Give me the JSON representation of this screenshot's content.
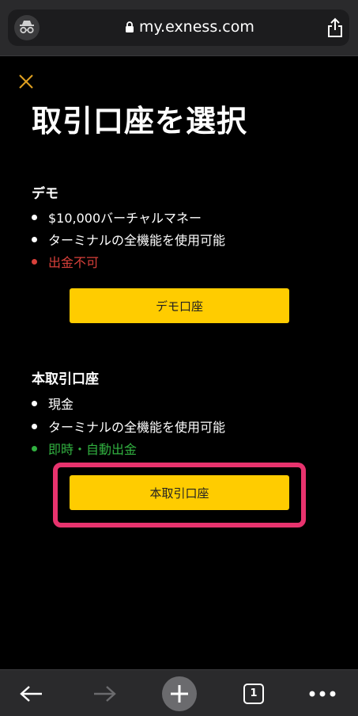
{
  "browser": {
    "url": "my.exness.com",
    "tab_count": "1"
  },
  "page": {
    "title": "取引口座を選択"
  },
  "demo": {
    "heading": "デモ",
    "features": [
      {
        "text": "$10,000バーチャルマネー",
        "color": "#ffffff"
      },
      {
        "text": "ターミナルの全機能を使用可能",
        "color": "#ffffff"
      },
      {
        "text": "出金不可",
        "color": "#d9403a"
      }
    ],
    "button_label": "デモ口座"
  },
  "real": {
    "heading": "本取引口座",
    "features": [
      {
        "text": "現金",
        "color": "#ffffff"
      },
      {
        "text": "ターミナルの全機能を使用可能",
        "color": "#ffffff"
      },
      {
        "text": "即時・自動出金",
        "color": "#31b040"
      }
    ],
    "button_label": "本取引口座"
  },
  "colors": {
    "accent": "#ffcc00",
    "highlight": "#e8336e",
    "close_icon": "#e0a020"
  }
}
